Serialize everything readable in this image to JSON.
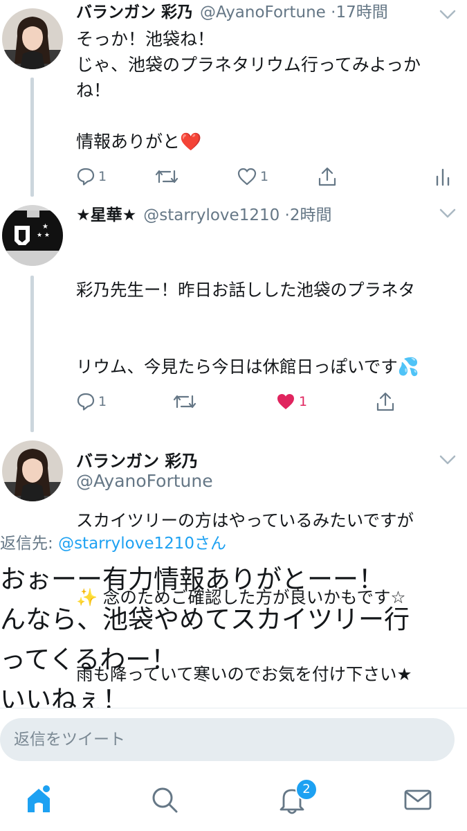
{
  "tweets": [
    {
      "name": "バランガン 彩乃",
      "handle": "@AyanoFortune",
      "separator": "·",
      "time": "17時間",
      "text": "そっか！池袋ね！\nじゃ、池袋のプラネタリウム行ってみよっか\nね！\n\n情報ありがと",
      "emoji": "❤️",
      "reply_count": "1",
      "like_count": "1",
      "avatar": "woman-portrait"
    },
    {
      "name": "★星華★",
      "handle": "@starrylove1210",
      "separator": "·",
      "time": "2時間",
      "line1": "彩乃先生ー！昨日お話しした池袋のプラネタ",
      "line2a": "リウム、今見たら今日は休館日っぽいです",
      "emoji_drops": "💦",
      "line4_emoji": "✨",
      "line3": "スカイツリーの方はやっているみたいですが",
      "line4": " 念のためご確認した方が良いかもです☆",
      "line5": "雨も降っていて寒いのでお気を付け下さい★",
      "reply_count": "1",
      "like_count": "1",
      "avatar": "store-sign"
    }
  ],
  "main_tweet": {
    "name": "バランガン 彩乃",
    "handle": "@AyanoFortune",
    "reply_to_label": "返信先:",
    "reply_to_handle": "@starrylove1210さん",
    "text": "おぉーー有力情報ありがとーー！\nんなら、池袋やめてスカイツリー行\nってくるわー！\nいいねぇ！"
  },
  "reply_bar": {
    "placeholder": "返信をツイート"
  },
  "tabbar": {
    "notification_badge": "2",
    "items": [
      "home-icon",
      "search-icon",
      "bell-icon",
      "mail-icon"
    ]
  },
  "colors": {
    "accent": "#1da1f2",
    "like": "#e0245e",
    "secondary_text": "#657786",
    "thread_line": "#ccd6dd"
  }
}
